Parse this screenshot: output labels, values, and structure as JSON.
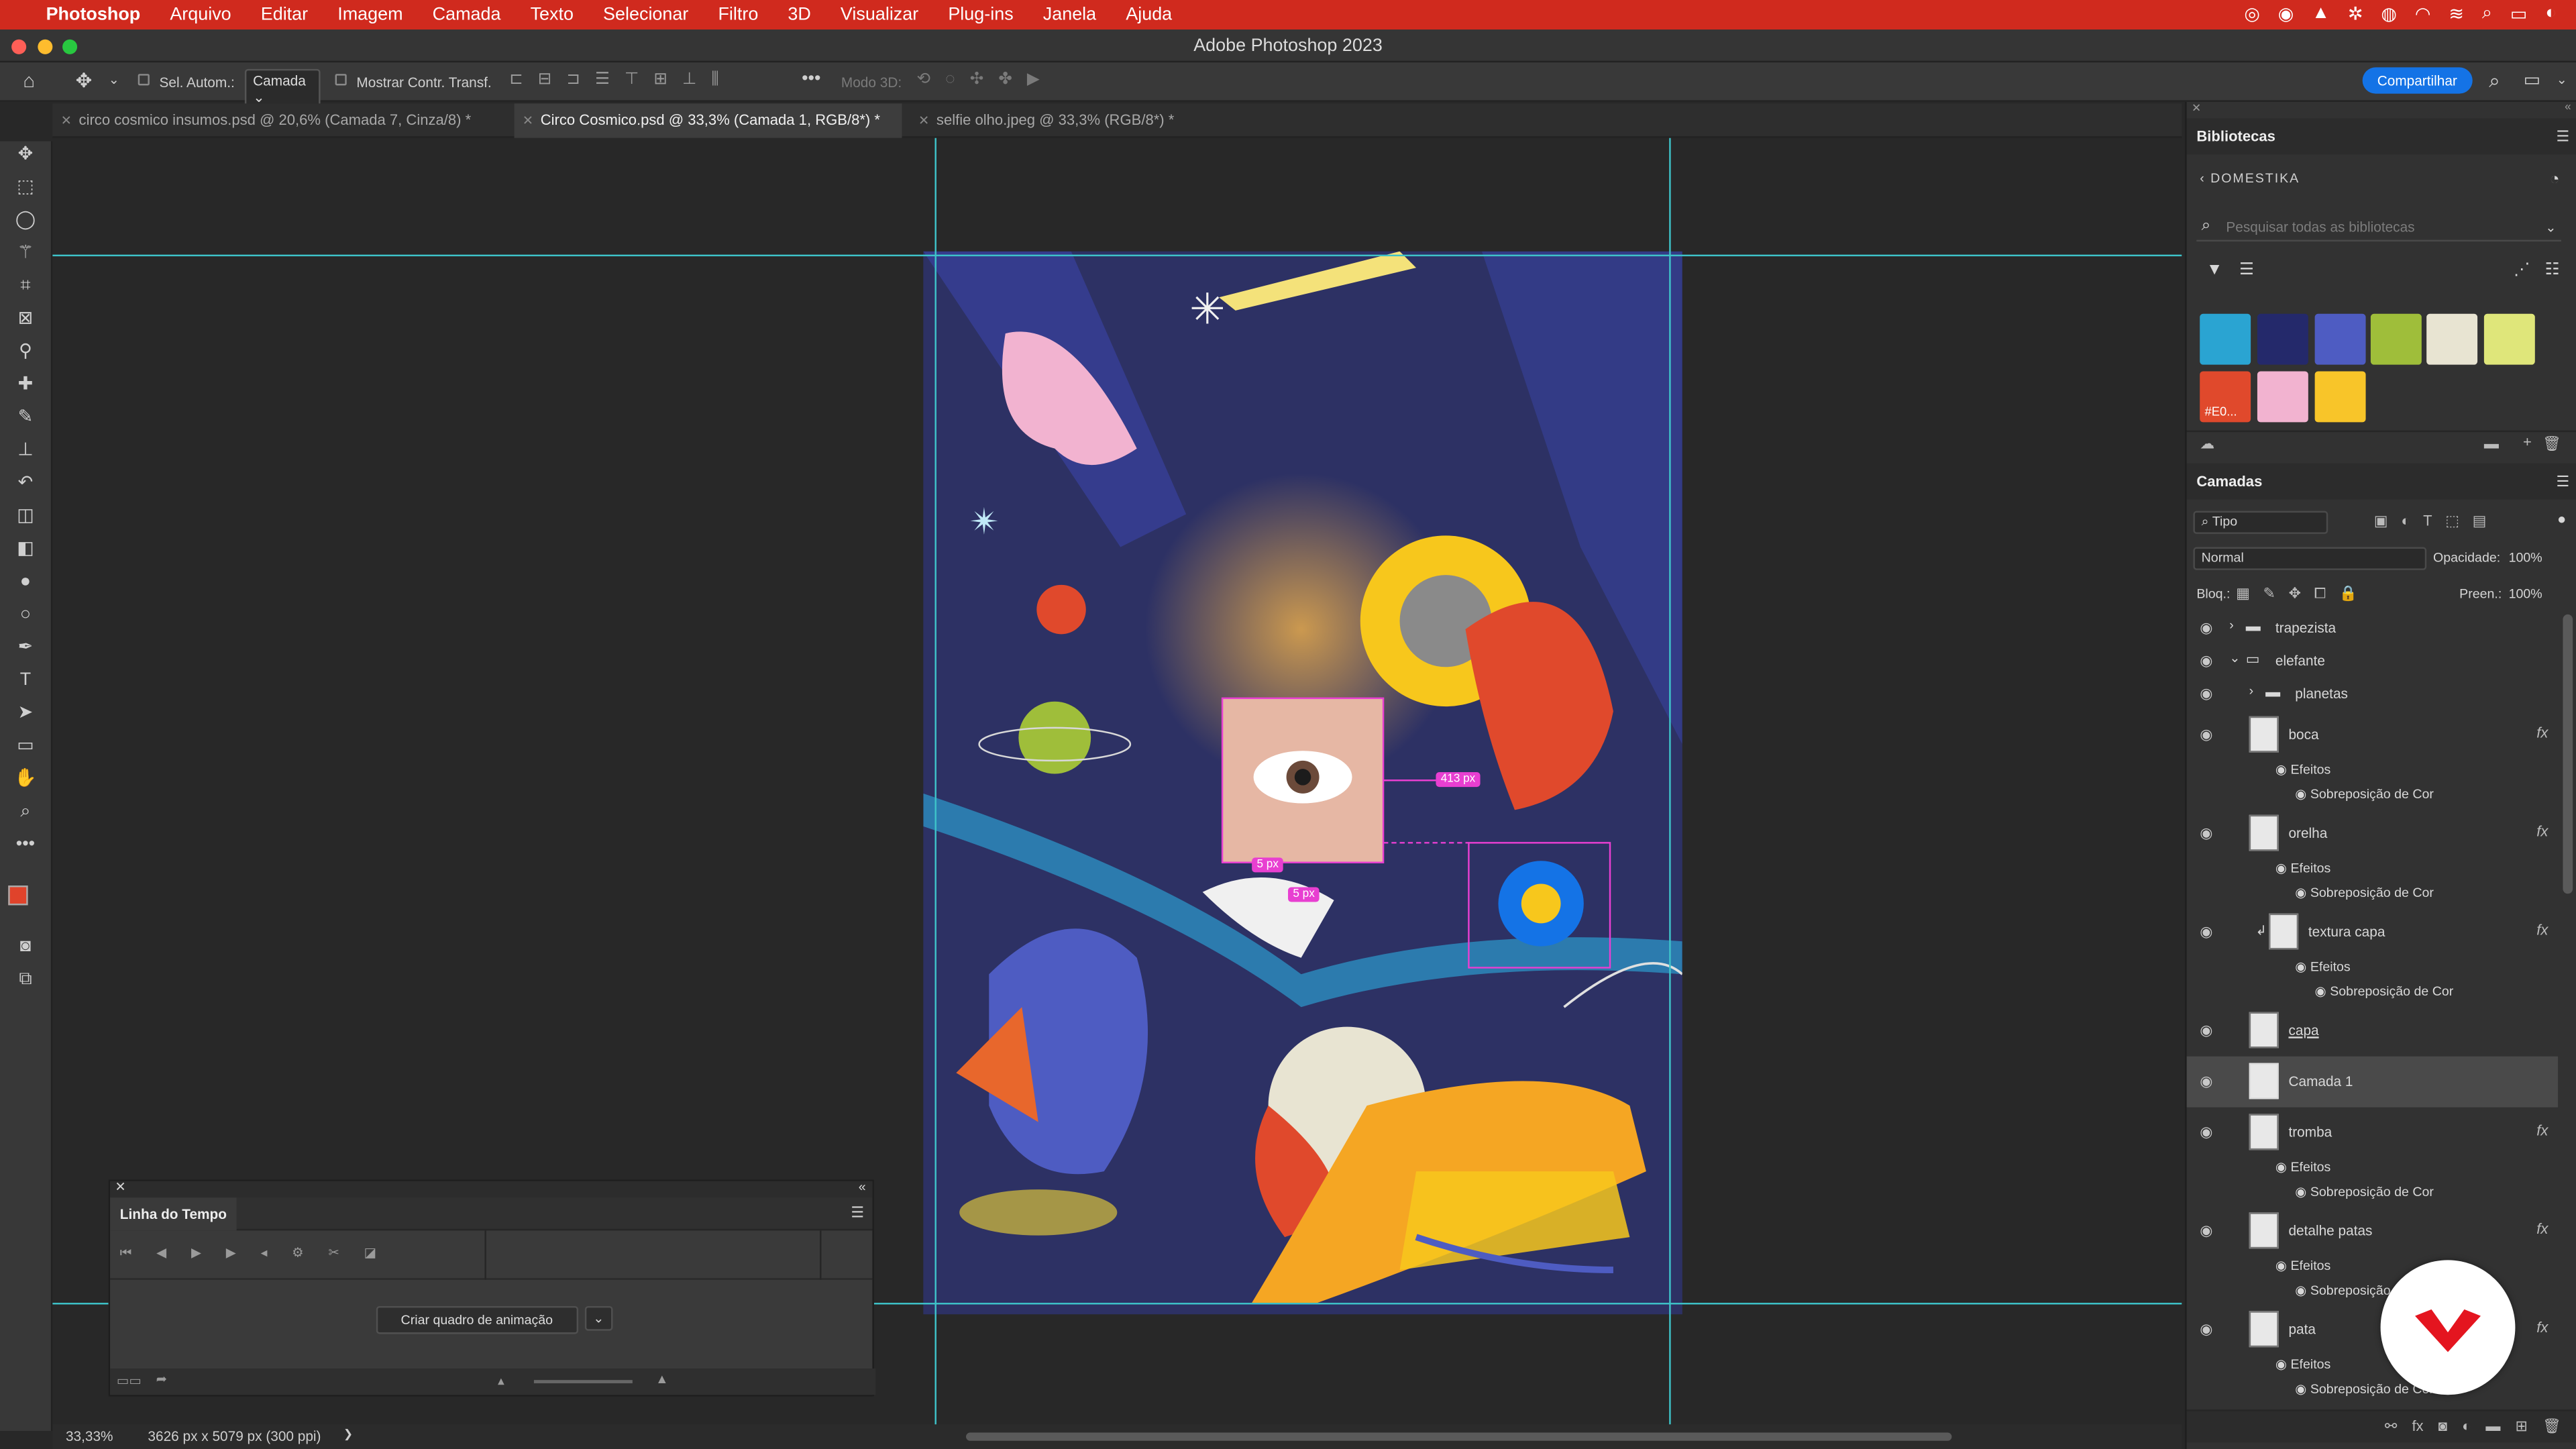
{
  "menubar": {
    "app_name": "Photoshop",
    "items": [
      "Arquivo",
      "Editar",
      "Imagem",
      "Camada",
      "Texto",
      "Selecionar",
      "Filtro",
      "3D",
      "Visualizar",
      "Plug-ins",
      "Janela",
      "Ajuda"
    ]
  },
  "window": {
    "title": "Adobe Photoshop 2023"
  },
  "options_bar": {
    "auto_select_label": "Sel. Autom.:",
    "auto_select_value": "Camada",
    "show_transform_label": "Mostrar Contr. Transf.",
    "mode_3d_label": "Modo 3D:",
    "share_label": "Compartilhar"
  },
  "tabs": [
    {
      "label": "circo cosmico insumos.psd @ 20,6% (Camada 7, Cinza/8) *"
    },
    {
      "label": "Circo Cosmico.psd @ 33,3% (Camada 1, RGB/8*) *"
    },
    {
      "label": "selfie olho.jpeg @ 33,3% (RGB/8*) *"
    }
  ],
  "canvas": {
    "measure_a": "413 px",
    "measure_b": "5 px",
    "measure_c": "5 px"
  },
  "status": {
    "zoom": "33,33%",
    "doc_info": "3626 px x 5079 px (300 ppi)",
    "arrow": "❯"
  },
  "timeline": {
    "title": "Linha do Tempo",
    "create_frame_label": "Criar quadro de animação"
  },
  "libraries": {
    "title": "Bibliotecas",
    "back_label": "DOMESTIKA",
    "search_placeholder": "Pesquisar todas as bibliotecas",
    "swatches": [
      {
        "color": "#2aa4d2"
      },
      {
        "color": "#24296b"
      },
      {
        "color": "#4e5cc2"
      },
      {
        "color": "#9fbe3a"
      },
      {
        "color": "#e8e4d2"
      },
      {
        "color": "#dfe67a"
      },
      {
        "color": "#e0492c",
        "label": "#E0..."
      },
      {
        "color": "#f2b3d0"
      },
      {
        "color": "#f8c529"
      }
    ]
  },
  "layers": {
    "title": "Camadas",
    "filter_label": "Tipo",
    "blend_mode": "Normal",
    "opacity_label": "Opacidade:",
    "opacity_value": "100%",
    "lock_label": "Bloq.:",
    "fill_label": "Preen.:",
    "fill_value": "100%",
    "items": [
      {
        "name": "trapezista",
        "kind": "group"
      },
      {
        "name": "elefante",
        "kind": "group-open"
      },
      {
        "name": "planetas",
        "kind": "group"
      },
      {
        "name": "boca",
        "kind": "layer",
        "fx": "fx",
        "effects": "Efeitos",
        "effect": "Sobreposição de Cor"
      },
      {
        "name": "orelha",
        "kind": "layer",
        "fx": "fx",
        "effects": "Efeitos",
        "effect": "Sobreposição de Cor"
      },
      {
        "name": "textura capa",
        "kind": "layer",
        "fx": "fx",
        "effects": "Efeitos",
        "effect": "Sobreposição de Cor"
      },
      {
        "name": "capa",
        "kind": "layer"
      },
      {
        "name": "Camada 1",
        "kind": "layer"
      },
      {
        "name": "tromba",
        "kind": "layer",
        "fx": "fx",
        "effects": "Efeitos",
        "effect": "Sobreposição de Cor"
      },
      {
        "name": "detalhe patas",
        "kind": "layer",
        "fx": "fx",
        "effects": "Efeitos",
        "effect": "Sobreposição de Cor"
      },
      {
        "name": "pata",
        "kind": "layer",
        "fx": "fx",
        "effects": "Efeitos",
        "effect": "Sobreposição de Cor"
      }
    ]
  }
}
